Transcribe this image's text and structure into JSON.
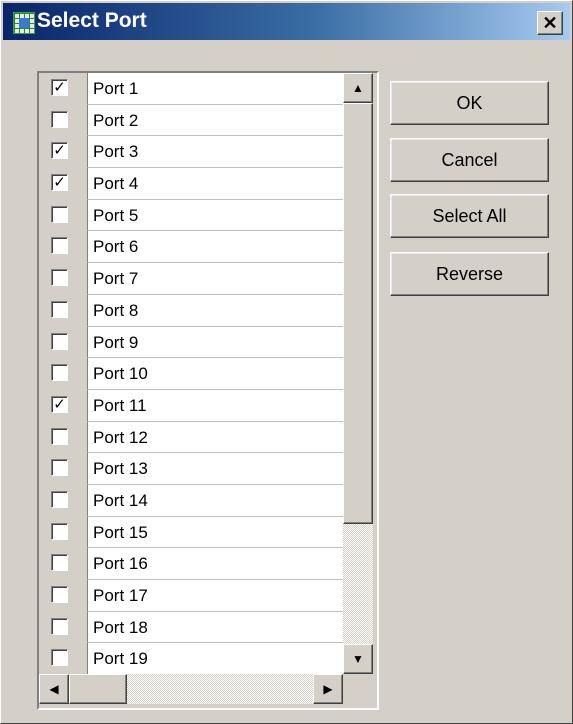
{
  "window": {
    "title": "Select Port",
    "close_glyph": "✕",
    "app_icon": "grid-app-icon"
  },
  "ports": [
    {
      "label": "Port 1",
      "checked": true
    },
    {
      "label": "Port 2",
      "checked": false
    },
    {
      "label": "Port 3",
      "checked": true
    },
    {
      "label": "Port 4",
      "checked": true
    },
    {
      "label": "Port 5",
      "checked": false
    },
    {
      "label": "Port 6",
      "checked": false
    },
    {
      "label": "Port 7",
      "checked": false
    },
    {
      "label": "Port 8",
      "checked": false
    },
    {
      "label": "Port 9",
      "checked": false
    },
    {
      "label": "Port 10",
      "checked": false
    },
    {
      "label": "Port 11",
      "checked": true
    },
    {
      "label": "Port 12",
      "checked": false
    },
    {
      "label": "Port 13",
      "checked": false
    },
    {
      "label": "Port 14",
      "checked": false
    },
    {
      "label": "Port 15",
      "checked": false
    },
    {
      "label": "Port 16",
      "checked": false
    },
    {
      "label": "Port 17",
      "checked": false
    },
    {
      "label": "Port 18",
      "checked": false
    },
    {
      "label": "Port 19",
      "checked": false
    }
  ],
  "buttons": {
    "ok": "OK",
    "cancel": "Cancel",
    "select_all": "Select All",
    "reverse": "Reverse"
  },
  "icons": {
    "check": "✓",
    "up": "▲",
    "down": "▼",
    "left": "◀",
    "right": "▶"
  },
  "colors": {
    "title_gradient_start": "#0a246a",
    "title_gradient_end": "#a6caf0",
    "face": "#d4d0c8"
  }
}
